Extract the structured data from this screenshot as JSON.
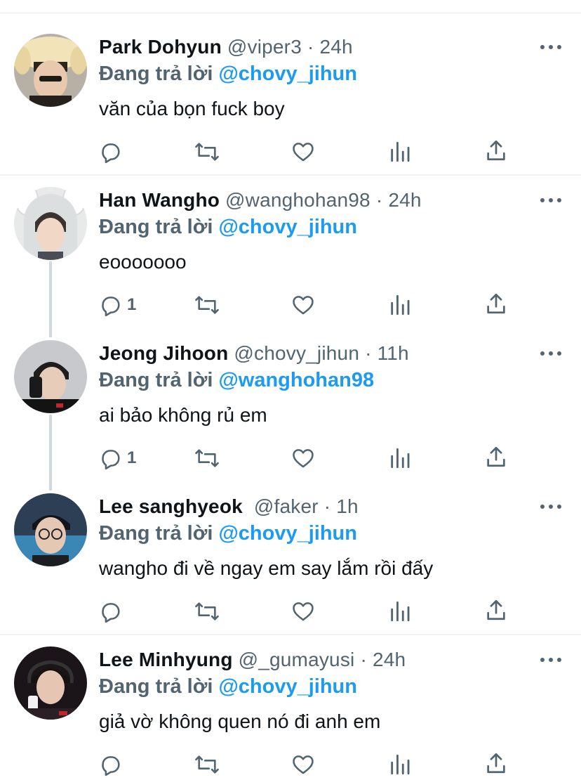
{
  "colors": {
    "mention": "#1d9bf0",
    "muted": "#536471",
    "text": "#0f1419",
    "thread_line": "#cfd9de"
  },
  "icons": [
    "reply-icon",
    "retweet-icon",
    "like-icon",
    "analytics-icon",
    "share-icon",
    "more-icon"
  ],
  "tweets": [
    {
      "name": "Park Dohyun",
      "handle": "@viper3",
      "time": "24h",
      "reply_prefix": "Đang trả lời",
      "reply_to": "@chovy_jihun",
      "text": "văn của bọn fuck boy",
      "reply_count": ""
    },
    {
      "name": "Han Wangho",
      "handle": "@wanghohan98",
      "time": "24h",
      "reply_prefix": "Đang trả lời",
      "reply_to": "@chovy_jihun",
      "text": "eooooooo",
      "reply_count": "1"
    },
    {
      "name": "Jeong Jihoon",
      "handle": "@chovy_jihun",
      "time": "11h",
      "reply_prefix": "Đang trả lời",
      "reply_to": "@wanghohan98",
      "text": "ai bảo không rủ em",
      "reply_count": "1"
    },
    {
      "name": "Lee sanghyeok",
      "handle": "@faker",
      "time": "1h",
      "reply_prefix": "Đang trả lời",
      "reply_to": "@chovy_jihun",
      "text": "wangho đi về ngay em say lắm rồi đấy",
      "reply_count": ""
    },
    {
      "name": "Lee Minhyung",
      "handle": "@_gumayusi",
      "time": "24h",
      "reply_prefix": "Đang trả lời",
      "reply_to": "@chovy_jihun",
      "text": "giả vờ không quen nó đi anh em",
      "reply_count": ""
    }
  ]
}
